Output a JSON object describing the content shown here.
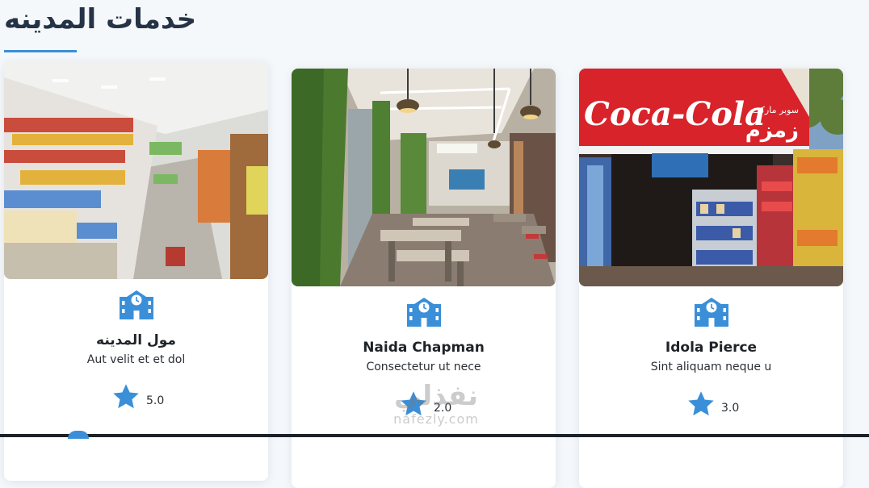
{
  "section": {
    "title": "خدمات المدينه"
  },
  "cards": [
    {
      "name": "مول المدينه",
      "description": "Aut velit et et dol",
      "rating": "5.0",
      "icon": "school-building-icon",
      "image": "supermarket-aisle-photo"
    },
    {
      "name": "Naida Chapman",
      "description": "Consectetur ut nece",
      "rating": "2.0",
      "icon": "school-building-icon",
      "image": "cafe-interior-photo"
    },
    {
      "name": "Idola Pierce",
      "description": "Sint aliquam neque u",
      "rating": "3.0",
      "icon": "school-building-icon",
      "image": "coca-cola-storefront-photo"
    }
  ],
  "store_sign": {
    "brand": "Coca-Cola",
    "arabic_small": "سوبر ماركت",
    "arabic_big": "زمزم"
  },
  "watermark": {
    "arabic": "نفذلي",
    "latin": "nafezly.com"
  },
  "colors": {
    "accent": "#3a8fd8",
    "title": "#253346",
    "background": "#f5f8fb",
    "card": "#ffffff"
  }
}
